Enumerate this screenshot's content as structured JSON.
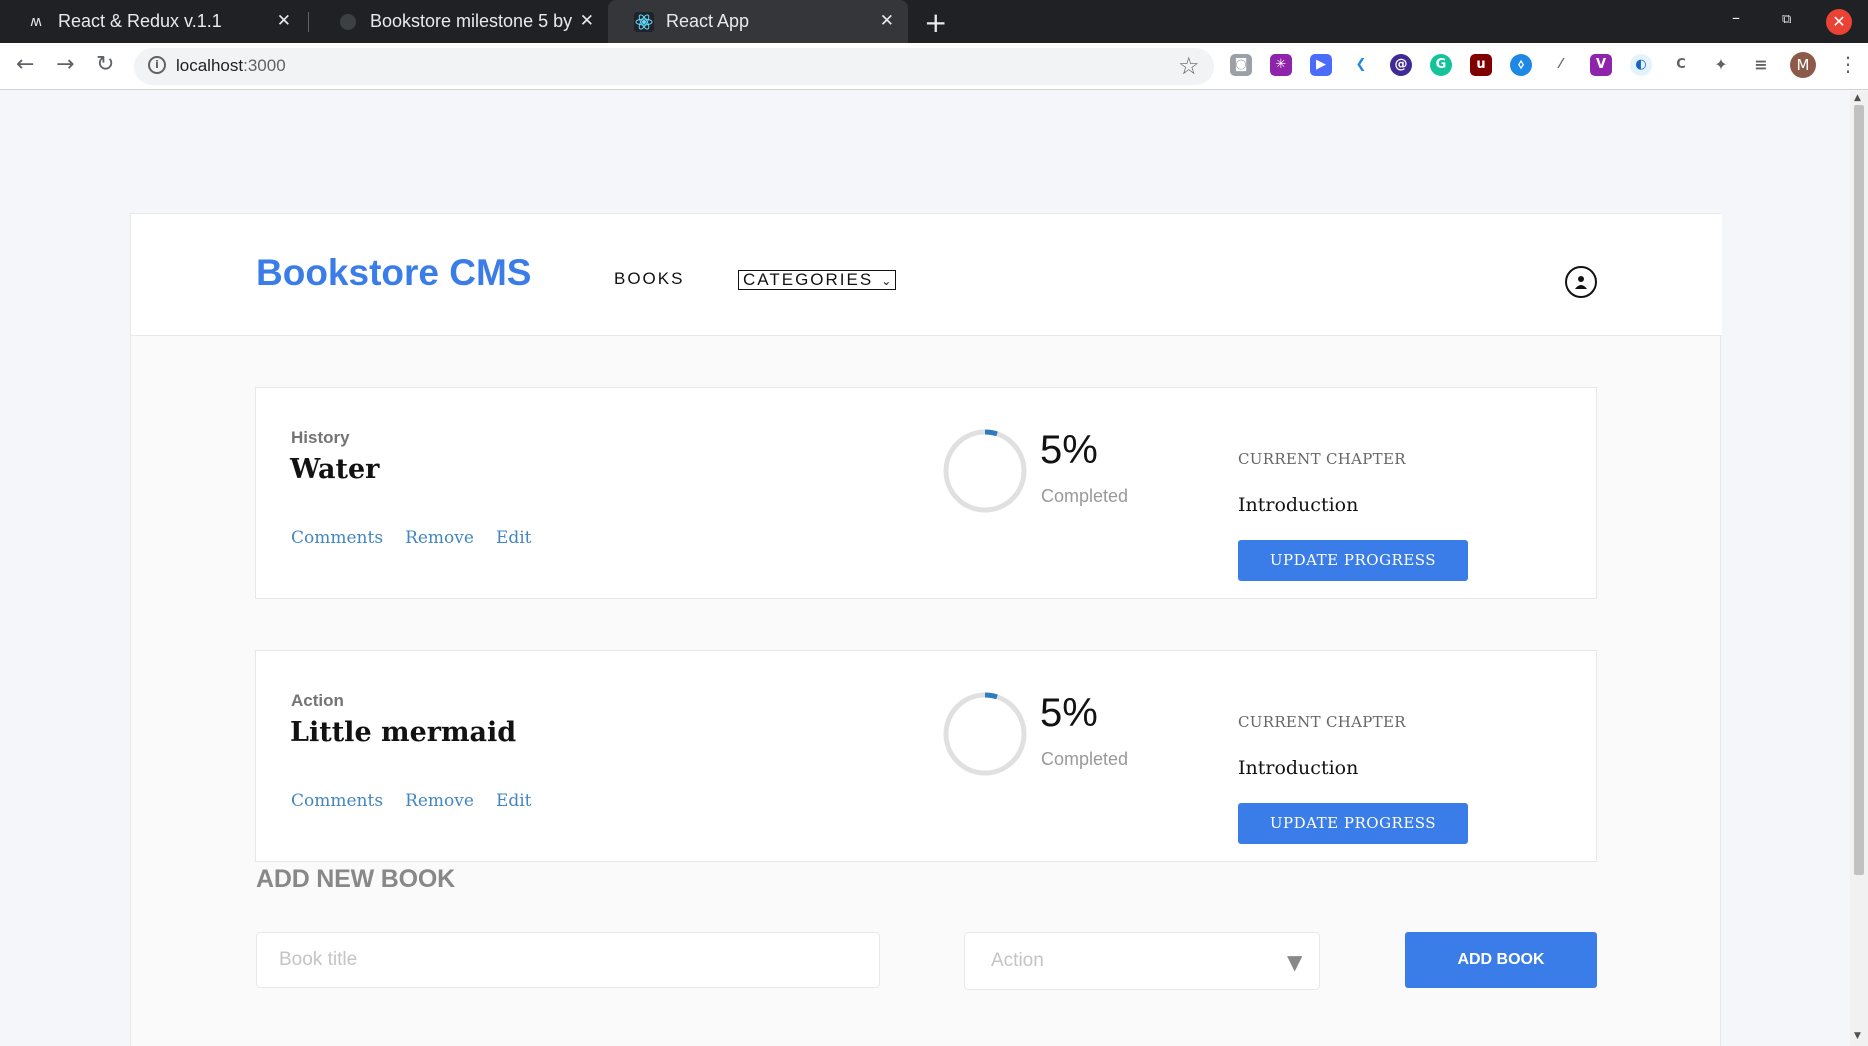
{
  "browser": {
    "tabs": [
      {
        "title": "React & Redux v.1.1",
        "icon": "m-logo-icon",
        "active": false
      },
      {
        "title": "Bookstore milestone 5 by",
        "icon": "github-icon",
        "active": false
      },
      {
        "title": "React App",
        "icon": "react-icon",
        "active": true
      }
    ],
    "url_host": "localhost",
    "url_port": ":3000",
    "profile_initial": "M"
  },
  "app": {
    "brand": "Bookstore CMS",
    "nav_books": "BOOKS",
    "nav_categories": "CATEGORIES",
    "accent_color": "#3b7de8"
  },
  "books": [
    {
      "category": "History",
      "title": "Water",
      "links": [
        "Comments",
        "Remove",
        "Edit"
      ],
      "progress_percent": 5,
      "progress_label": "5%",
      "completed_label": "Completed",
      "chapter_label": "CURRENT CHAPTER",
      "chapter": "Introduction",
      "update_label": "UPDATE PROGRESS"
    },
    {
      "category": "Action",
      "title": "Little mermaid",
      "links": [
        "Comments",
        "Remove",
        "Edit"
      ],
      "progress_percent": 5,
      "progress_label": "5%",
      "completed_label": "Completed",
      "chapter_label": "CURRENT CHAPTER",
      "chapter": "Introduction",
      "update_label": "UPDATE PROGRESS"
    }
  ],
  "add_form": {
    "heading": "ADD NEW BOOK",
    "title_placeholder": "Book title",
    "category_value": "Action",
    "submit_label": "ADD BOOK"
  }
}
